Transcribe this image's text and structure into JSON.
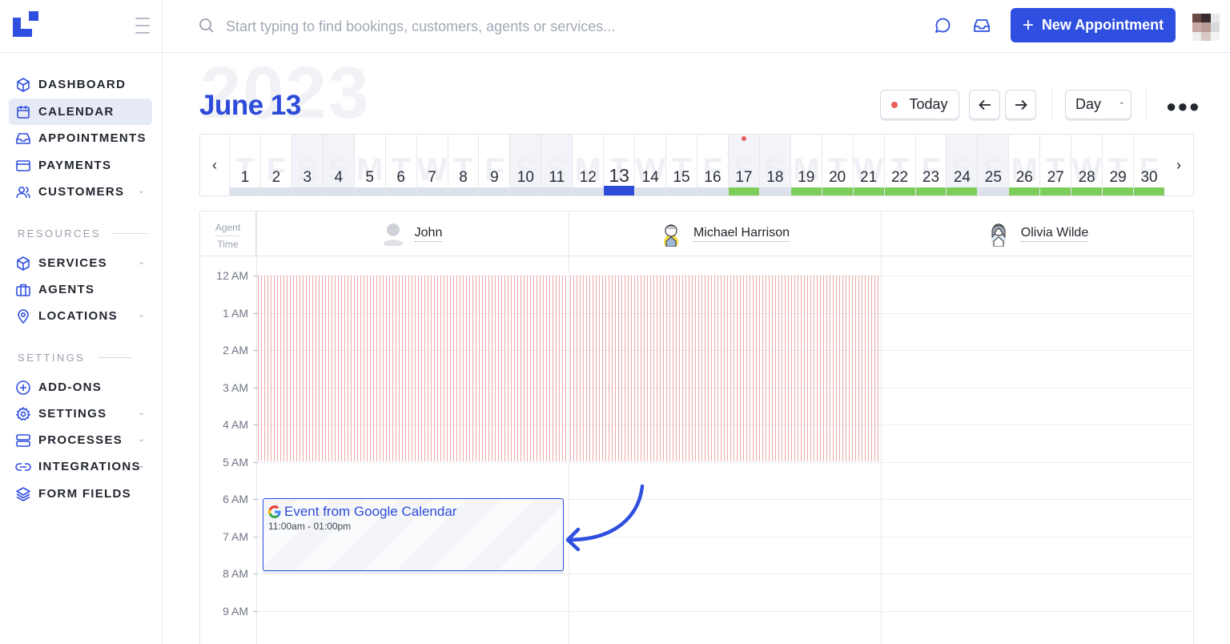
{
  "search": {
    "placeholder": "Start typing to find bookings, customers, agents or services..."
  },
  "toolbar": {
    "new_appointment_label": "New Appointment"
  },
  "sidebar": {
    "items": [
      {
        "label": "DASHBOARD",
        "icon": "cube-icon"
      },
      {
        "label": "CALENDAR",
        "icon": "calendar-icon",
        "active": true
      },
      {
        "label": "APPOINTMENTS",
        "icon": "inbox-icon"
      },
      {
        "label": "PAYMENTS",
        "icon": "credit-card-icon"
      },
      {
        "label": "CUSTOMERS",
        "icon": "users-icon",
        "has_submenu": true
      }
    ],
    "resources_title": "RESOURCES",
    "resources": [
      {
        "label": "SERVICES",
        "icon": "cube-icon",
        "has_submenu": true
      },
      {
        "label": "AGENTS",
        "icon": "briefcase-icon"
      },
      {
        "label": "LOCATIONS",
        "icon": "map-pin-icon",
        "has_submenu": true
      }
    ],
    "settings_title": "SETTINGS",
    "settings": [
      {
        "label": "ADD-ONS",
        "icon": "plus-circle-icon"
      },
      {
        "label": "SETTINGS",
        "icon": "gear-icon",
        "has_submenu": true
      },
      {
        "label": "PROCESSES",
        "icon": "server-icon",
        "has_submenu": true
      },
      {
        "label": "INTEGRATIONS",
        "icon": "link-icon",
        "has_submenu": true
      },
      {
        "label": "FORM FIELDS",
        "icon": "layers-icon"
      }
    ]
  },
  "header": {
    "year": "2023",
    "title": "June 13",
    "today_label": "Today",
    "view_select": "Day"
  },
  "day_strip": {
    "days": [
      {
        "n": "1",
        "l": "T",
        "w": false,
        "bar": "grey"
      },
      {
        "n": "2",
        "l": "F",
        "w": false,
        "bar": "grey"
      },
      {
        "n": "3",
        "l": "S",
        "w": true,
        "bar": "grey"
      },
      {
        "n": "4",
        "l": "S",
        "w": true,
        "bar": "grey"
      },
      {
        "n": "5",
        "l": "M",
        "w": false,
        "bar": "grey"
      },
      {
        "n": "6",
        "l": "T",
        "w": false,
        "bar": "grey"
      },
      {
        "n": "7",
        "l": "W",
        "w": false,
        "bar": "grey"
      },
      {
        "n": "8",
        "l": "T",
        "w": false,
        "bar": "grey"
      },
      {
        "n": "9",
        "l": "F",
        "w": false,
        "bar": "grey"
      },
      {
        "n": "10",
        "l": "S",
        "w": true,
        "bar": "grey"
      },
      {
        "n": "11",
        "l": "S",
        "w": true,
        "bar": "grey"
      },
      {
        "n": "12",
        "l": "M",
        "w": false,
        "bar": "grey"
      },
      {
        "n": "13",
        "l": "T",
        "w": false,
        "bar": "blue",
        "today": true
      },
      {
        "n": "14",
        "l": "W",
        "w": false,
        "bar": "grey"
      },
      {
        "n": "15",
        "l": "T",
        "w": false,
        "bar": "grey"
      },
      {
        "n": "16",
        "l": "F",
        "w": false,
        "bar": "grey"
      },
      {
        "n": "17",
        "l": "S",
        "w": true,
        "bar": "green",
        "marker": true
      },
      {
        "n": "18",
        "l": "S",
        "w": true,
        "bar": "grey"
      },
      {
        "n": "19",
        "l": "M",
        "w": false,
        "bar": "green"
      },
      {
        "n": "20",
        "l": "T",
        "w": false,
        "bar": "green"
      },
      {
        "n": "21",
        "l": "W",
        "w": false,
        "bar": "green"
      },
      {
        "n": "22",
        "l": "T",
        "w": false,
        "bar": "green"
      },
      {
        "n": "23",
        "l": "F",
        "w": false,
        "bar": "green"
      },
      {
        "n": "24",
        "l": "S",
        "w": true,
        "bar": "green"
      },
      {
        "n": "25",
        "l": "S",
        "w": true,
        "bar": "grey"
      },
      {
        "n": "26",
        "l": "M",
        "w": false,
        "bar": "green"
      },
      {
        "n": "27",
        "l": "T",
        "w": false,
        "bar": "green"
      },
      {
        "n": "28",
        "l": "W",
        "w": false,
        "bar": "green"
      },
      {
        "n": "29",
        "l": "T",
        "w": false,
        "bar": "green"
      },
      {
        "n": "30",
        "l": "F",
        "w": false,
        "bar": "green"
      }
    ]
  },
  "grid": {
    "corner_top": "Agent",
    "corner_bottom": "Time",
    "agents": [
      {
        "name": "John",
        "avatar": "default-avatar-icon"
      },
      {
        "name": "Michael Harrison",
        "avatar": "illustrated-avatar-icon"
      },
      {
        "name": "Olivia Wilde",
        "avatar": "illustrated-avatar-icon"
      }
    ],
    "hours": [
      "12 AM",
      "1 AM",
      "2 AM",
      "3 AM",
      "4 AM",
      "5 AM",
      "6 AM",
      "7 AM",
      "8 AM",
      "9 AM"
    ],
    "event": {
      "title": "Event from Google Calendar",
      "time": "11:00am - 01:00pm",
      "icon": "google-icon"
    }
  },
  "colors": {
    "accent": "#2f4fe0",
    "available": "#7ccd5a",
    "unavailable": "#f1a9a9",
    "today_dot": "#e8605b"
  }
}
